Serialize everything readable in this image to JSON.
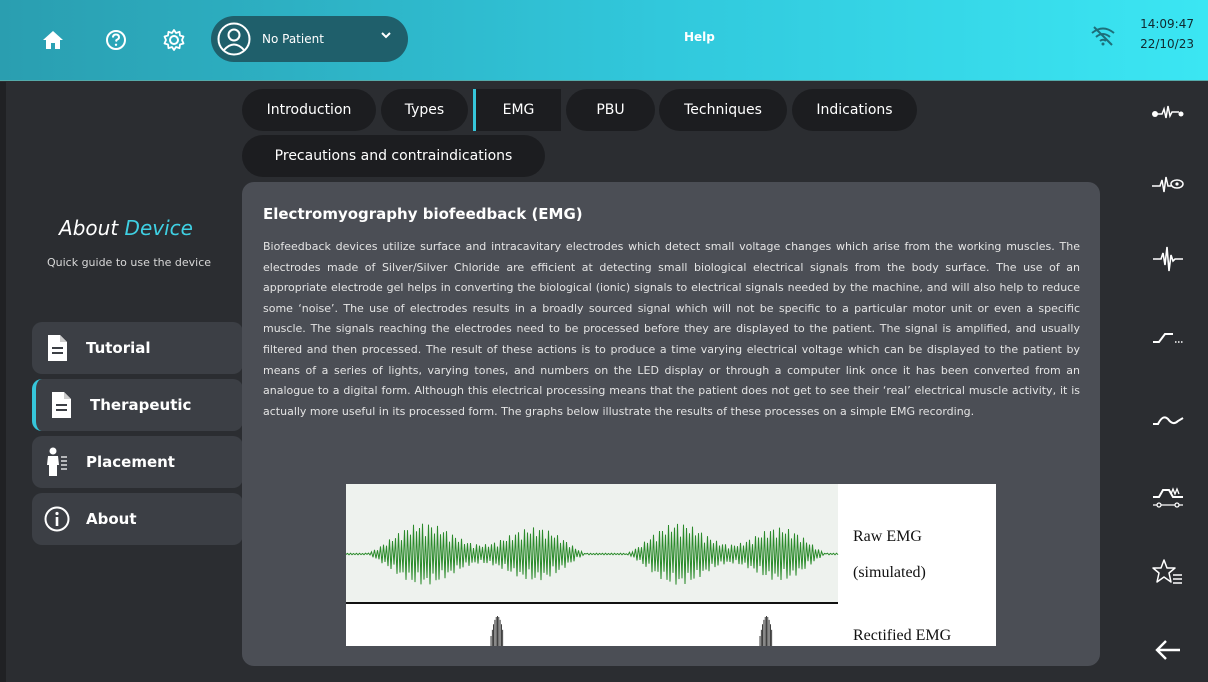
{
  "topbar": {
    "patient_name": "No Patient",
    "title": "Help",
    "time": "14:09:47",
    "date": "22/10/23"
  },
  "sidebar": {
    "heading_prefix": "About",
    "heading_accent": "Device",
    "subtitle": "Quick guide to use the device",
    "items": [
      {
        "label": "Tutorial",
        "icon": "document-icon"
      },
      {
        "label": "Therapeutic",
        "icon": "document-icon"
      },
      {
        "label": "Placement",
        "icon": "body-placement-icon"
      },
      {
        "label": "About",
        "icon": "info-icon"
      }
    ]
  },
  "tabs": [
    {
      "label": "Introduction"
    },
    {
      "label": "Types"
    },
    {
      "label": "EMG"
    },
    {
      "label": "PBU"
    },
    {
      "label": "Techniques"
    },
    {
      "label": "Indications"
    },
    {
      "label": "Precautions and contraindications"
    }
  ],
  "content": {
    "title": "Electromyography biofeedback (EMG)",
    "body": "Biofeedback devices utilize surface and intracavitary electrodes which detect small voltage changes which arise from the working muscles. The electrodes made of Silver/Silver Chloride are efficient at detecting small biological electrical signals from the body surface. The use of an appropriate electrode gel helps in converting the biological (ionic) signals to electrical signals needed by the machine, and will also help to reduce some ‘noise’. The use of electrodes results in a broadly sourced signal which will not be specific to a particular motor unit or even a specific muscle. The signals reaching the electrodes need to be processed before they are displayed to the patient. The signal is amplified, and usually filtered and then processed. The result of these actions is to produce a time varying electrical voltage which can be displayed to the patient by means of a series of lights, varying tones, and numbers on the LED display or through a computer link once it has been converted from an analogue to a digital form. Although this electrical processing means that the patient does not get to see their ‘real’ electrical muscle activity, it is actually more useful in its processed form. The graphs below illustrate the results of these processes on a simple EMG recording.",
    "figure": {
      "raw_label_line1": "Raw EMG",
      "raw_label_line2": "(simulated)",
      "rectified_label": "Rectified EMG",
      "raw_color": "#2a8a2a"
    }
  },
  "right_rail": {
    "icons": [
      "emg-electrode-icon",
      "emg-view-icon",
      "emg-signal-icon",
      "ramp-wave-icon",
      "sine-wave-icon",
      "stim-mode-icon",
      "favorites-list-icon",
      "back-arrow-icon"
    ]
  },
  "colors": {
    "accent": "#3fd0e3",
    "background": "#2b2d31",
    "card": "#4b4e55"
  }
}
